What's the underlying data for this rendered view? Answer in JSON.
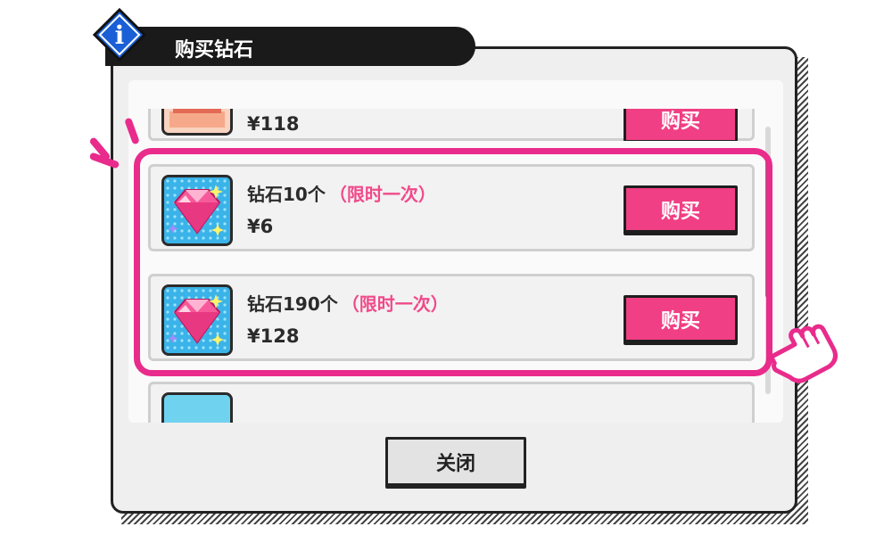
{
  "dialog": {
    "title": "购买钻石",
    "info_icon": "info-icon",
    "close_label": "关闭"
  },
  "items": [
    {
      "name": "",
      "tag": "",
      "price": "¥118",
      "buy_label": "购买",
      "icon": "diamond-pack-icon"
    },
    {
      "name": "钻石10个",
      "tag": "（限时一次）",
      "price": "¥6",
      "buy_label": "购买",
      "icon": "diamond-icon"
    },
    {
      "name": "钻石190个",
      "tag": "（限时一次）",
      "price": "¥128",
      "buy_label": "购买",
      "icon": "diamond-icon"
    }
  ],
  "colors": {
    "accent": "#f03f84",
    "highlight": "#e92b8c",
    "panel": "#efefef",
    "title_bar": "#1a1a1a"
  },
  "decor": {
    "pointer": "hand-pointer-icon"
  }
}
